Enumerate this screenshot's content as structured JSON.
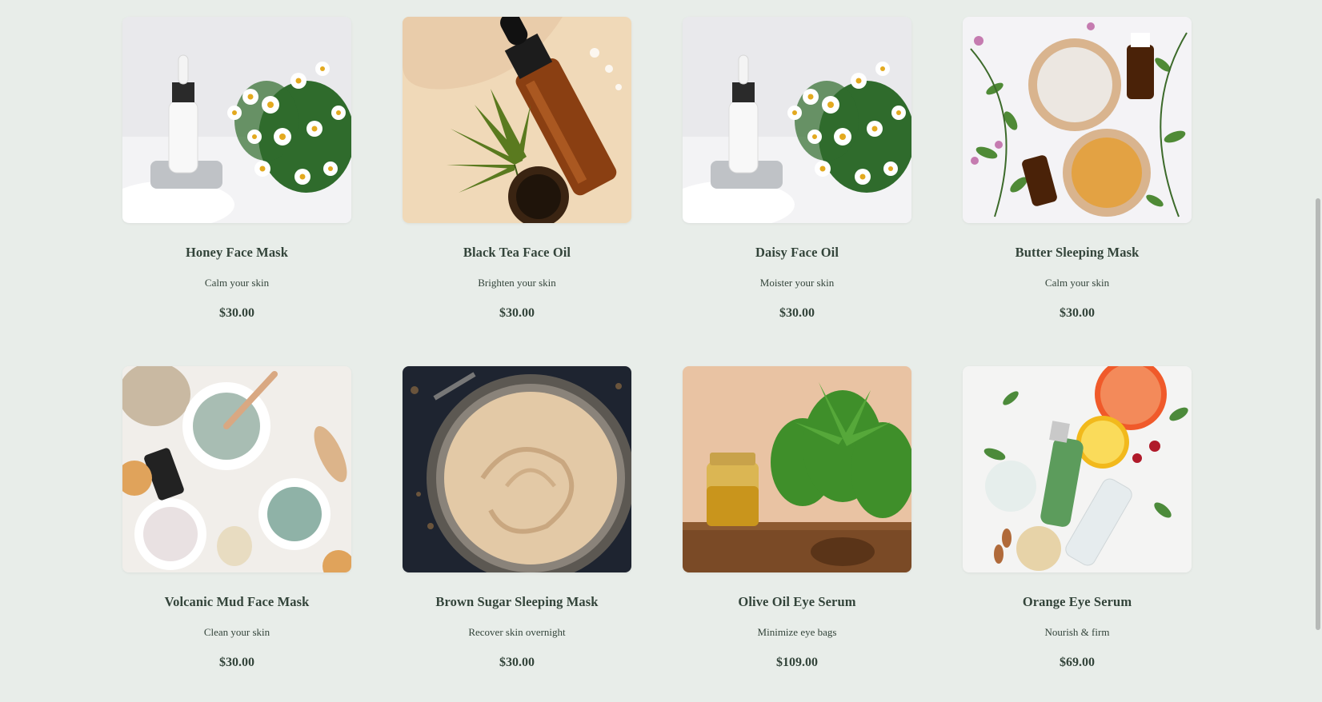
{
  "products": [
    {
      "name": "Honey Face Mask",
      "desc": "Calm your skin",
      "price": "$30.00",
      "image": "serum-daisy-photo"
    },
    {
      "name": "Black Tea Face Oil",
      "desc": "Brighten your skin",
      "price": "$30.00",
      "image": "amber-dropper-leaf-photo"
    },
    {
      "name": "Daisy Face Oil",
      "desc": "Moister your skin",
      "price": "$30.00",
      "image": "serum-daisy-photo"
    },
    {
      "name": "Butter Sleeping Mask",
      "desc": "Calm your skin",
      "price": "$30.00",
      "image": "clay-bowls-herbs-photo"
    },
    {
      "name": "Volcanic Mud Face Mask",
      "desc": "Clean your skin",
      "price": "$30.00",
      "image": "green-clay-bowls-photo"
    },
    {
      "name": "Brown Sugar Sleeping Mask",
      "desc": "Recover skin overnight",
      "price": "$30.00",
      "image": "cream-jar-photo"
    },
    {
      "name": "Olive Oil Eye Serum",
      "desc": "Minimize eye bags",
      "price": "$109.00",
      "image": "oil-jar-plant-photo"
    },
    {
      "name": "Orange Eye Serum",
      "desc": "Nourish & firm",
      "price": "$69.00",
      "image": "citrus-bottles-photo"
    }
  ],
  "colors": {
    "background": "#e8ede9",
    "text": "#33443a"
  }
}
